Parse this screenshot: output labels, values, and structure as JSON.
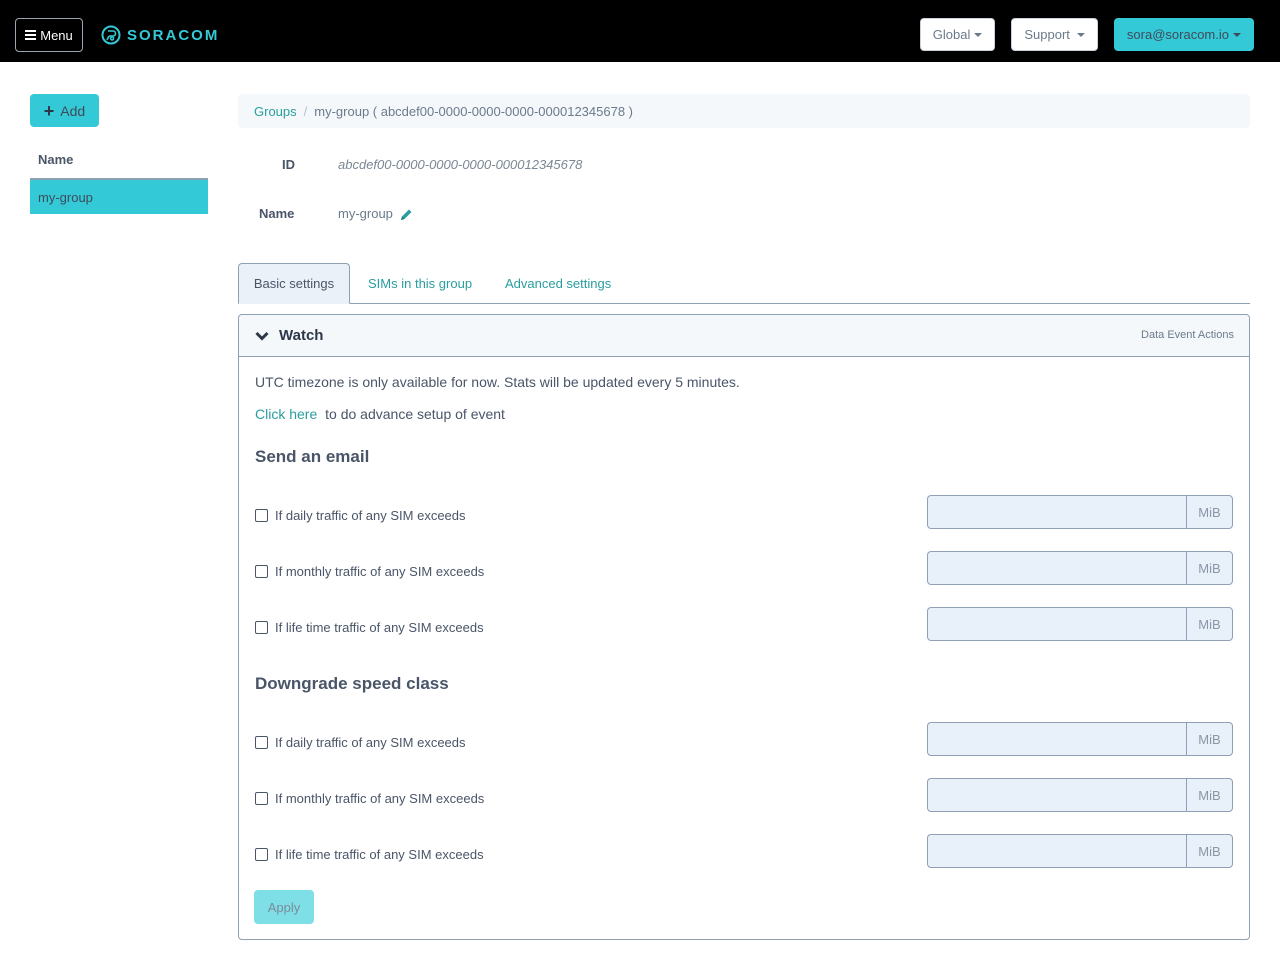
{
  "navbar": {
    "menu_label": "Menu",
    "brand": "SORACOM",
    "brand_color": "#34c9d6",
    "region_label": "Global",
    "support_label": "Support",
    "user_label": "sora@soracom.io"
  },
  "sidebar": {
    "add_label": "Add",
    "column_header": "Name",
    "items": [
      {
        "label": "my-group",
        "selected": true
      }
    ]
  },
  "breadcrumb": {
    "root": "Groups",
    "separator": "/",
    "current": "my-group ( abcdef00-0000-0000-0000-000012345678 )"
  },
  "info": {
    "id_label": "ID",
    "id_value": "abcdef00-0000-0000-0000-000012345678",
    "name_label": "Name",
    "name_value": "my-group"
  },
  "tabs": [
    {
      "label": "Basic settings",
      "active": true
    },
    {
      "label": "SIMs in this group",
      "active": false
    },
    {
      "label": "Advanced settings",
      "active": false
    }
  ],
  "panel": {
    "title": "Watch",
    "aux_label": "Data Event Actions",
    "note": "UTC timezone is only available for now. Stats will be updated every 5 minutes.",
    "advance_link": "Click here",
    "advance_text": "to do advance setup of event",
    "sections": [
      {
        "title": "Send an email",
        "rows": [
          {
            "label": "If daily traffic of any SIM exceeds",
            "checked": false,
            "value": "",
            "unit": "MiB"
          },
          {
            "label": "If monthly traffic of any SIM exceeds",
            "checked": false,
            "value": "",
            "unit": "MiB"
          },
          {
            "label": "If life time traffic of any SIM exceeds",
            "checked": false,
            "value": "",
            "unit": "MiB"
          }
        ]
      },
      {
        "title": "Downgrade speed class",
        "rows": [
          {
            "label": "If daily traffic of any SIM exceeds",
            "checked": false,
            "value": "",
            "unit": "MiB"
          },
          {
            "label": "If monthly traffic of any SIM exceeds",
            "checked": false,
            "value": "",
            "unit": "MiB"
          },
          {
            "label": "If life time traffic of any SIM exceeds",
            "checked": false,
            "value": "",
            "unit": "MiB"
          }
        ]
      }
    ],
    "apply_label": "Apply",
    "apply_disabled": true
  }
}
